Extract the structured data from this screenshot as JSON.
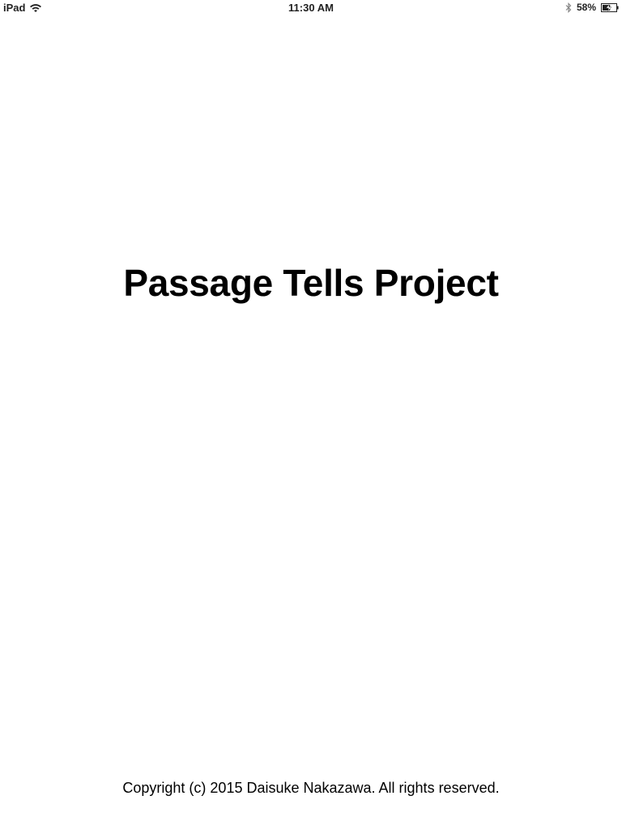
{
  "status_bar": {
    "device": "iPad",
    "time": "11:30 AM",
    "battery_percent": "58%",
    "battery_level": 0.58,
    "icons": [
      "wifi-icon",
      "bluetooth-icon",
      "battery-charging-icon"
    ]
  },
  "main": {
    "title": "Passage Tells Project"
  },
  "footer": {
    "copyright": "Copyright (c) 2015 Daisuke Nakazawa. All rights reserved."
  }
}
